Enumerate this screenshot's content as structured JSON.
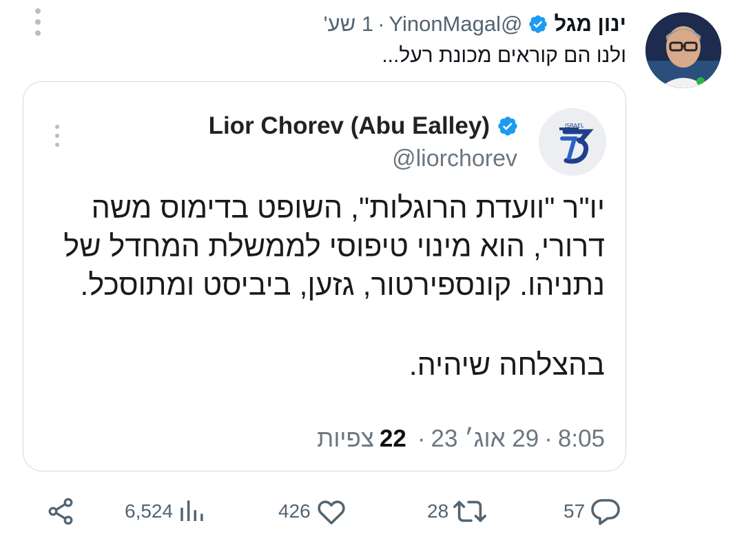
{
  "tweet": {
    "author_name": "ינון מגל",
    "handle": "@YinonMagal",
    "separator": "·",
    "time": "1 שע'",
    "text": "ולנו הם קוראים מכונת רעל..."
  },
  "quoted_tweet": {
    "author_name": "Lior Chorev (Abu Ealley)",
    "handle": "@liorchorev",
    "body_lines": [
      "יו\"ר \"וועדת הרוגלות\", השופט בדימוס משה",
      "דרורי, הוא מינוי טיפוסי לממשלת המחדל של",
      "נתניהו.  קונספירטור, גזען, ביביסט ומתוסכל."
    ],
    "closing_line": "בהצלחה שיהיה.",
    "time": "8:05",
    "date": "29 אוג׳ 23",
    "views_count": "22",
    "views_label": "צפיות",
    "separator": "·"
  },
  "actions": {
    "replies": "57",
    "retweets": "28",
    "likes": "426",
    "views": "6,524"
  },
  "icons": {
    "verified": "verified-badge-icon",
    "more": "more-options-icon",
    "reply": "reply-icon",
    "retweet": "retweet-icon",
    "like": "heart-icon",
    "views": "views-chart-icon",
    "share": "share-icon"
  },
  "colors": {
    "verified_blue": "#1d9bf0",
    "secondary_text": "#536471",
    "border": "#cfd9de"
  }
}
